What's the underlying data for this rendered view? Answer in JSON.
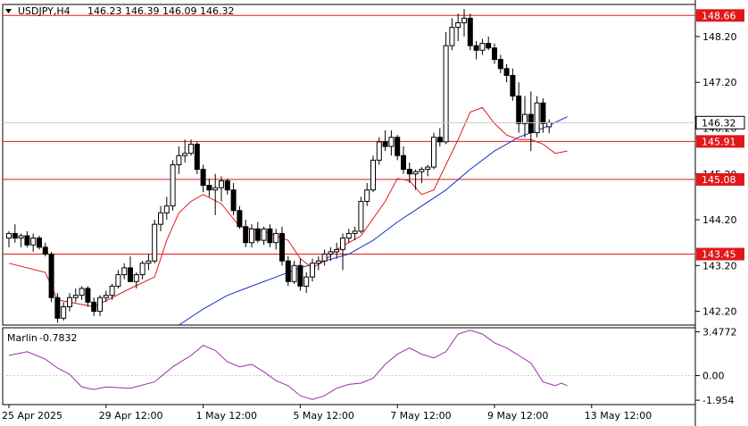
{
  "header": {
    "symbol": "USDJPY,H4",
    "ohlc": "146.23 146.39 146.09 146.32"
  },
  "indicator": {
    "name": "Marlin",
    "value": "-0.7832"
  },
  "colors": {
    "bull": "#ffffff",
    "bear": "#000000",
    "ma_fast": "#e0181c",
    "ma_slow": "#1030c8",
    "osc": "#9b2ea8",
    "level": "#e0181c",
    "grid": "#c8c8c8"
  },
  "chart_data": [
    {
      "type": "candlestick",
      "ylim": [
        141.9,
        148.9
      ],
      "price_ticks": [
        "148.20",
        "147.20",
        "146.20",
        "145.20",
        "144.20",
        "143.20",
        "142.20"
      ],
      "current_price": "146.32",
      "levels": [
        {
          "value": 148.66,
          "label": "148.66"
        },
        {
          "value": 145.91,
          "label": "145.91"
        },
        {
          "value": 145.08,
          "label": "145.08"
        },
        {
          "value": 143.45,
          "label": "143.45"
        }
      ],
      "time_labels": [
        "25 Apr 2025",
        "29 Apr 12:00",
        "1 May 12:00",
        "5 May 12:00",
        "7 May 12:00",
        "9 May 12:00",
        "13 May 12:00"
      ],
      "time_label_bars": [
        0,
        16,
        32,
        48,
        64,
        80,
        96
      ],
      "ohlc": [
        [
          143.8,
          143.95,
          143.6,
          143.9
        ],
        [
          143.9,
          144.1,
          143.7,
          143.8
        ],
        [
          143.8,
          143.9,
          143.6,
          143.85
        ],
        [
          143.85,
          143.95,
          143.6,
          143.65
        ],
        [
          143.65,
          143.9,
          143.5,
          143.8
        ],
        [
          143.8,
          143.85,
          143.55,
          143.6
        ],
        [
          143.6,
          143.7,
          143.4,
          143.45
        ],
        [
          143.45,
          143.5,
          142.4,
          142.5
        ],
        [
          142.5,
          142.6,
          141.95,
          142.05
        ],
        [
          142.05,
          142.4,
          142.0,
          142.3
        ],
        [
          142.3,
          142.6,
          142.2,
          142.5
        ],
        [
          142.5,
          142.7,
          142.4,
          142.55
        ],
        [
          142.55,
          142.75,
          142.45,
          142.7
        ],
        [
          142.7,
          142.75,
          142.3,
          142.4
        ],
        [
          142.4,
          142.5,
          142.1,
          142.2
        ],
        [
          142.2,
          142.55,
          142.1,
          142.5
        ],
        [
          142.5,
          142.65,
          142.4,
          142.55
        ],
        [
          142.55,
          142.8,
          142.45,
          142.75
        ],
        [
          142.75,
          143.1,
          142.7,
          143.0
        ],
        [
          143.0,
          143.25,
          142.9,
          143.15
        ],
        [
          143.15,
          143.4,
          143.0,
          142.85
        ],
        [
          142.85,
          143.05,
          142.7,
          143.0
        ],
        [
          143.0,
          143.3,
          142.9,
          143.25
        ],
        [
          143.25,
          143.45,
          143.1,
          143.3
        ],
        [
          143.3,
          144.2,
          143.25,
          144.1
        ],
        [
          144.1,
          144.5,
          143.95,
          144.35
        ],
        [
          144.35,
          144.7,
          144.2,
          144.5
        ],
        [
          144.5,
          145.5,
          144.4,
          145.4
        ],
        [
          145.4,
          145.8,
          145.2,
          145.6
        ],
        [
          145.6,
          145.95,
          145.45,
          145.65
        ],
        [
          145.65,
          145.95,
          145.6,
          145.85
        ],
        [
          145.85,
          145.9,
          145.2,
          145.3
        ],
        [
          145.3,
          145.4,
          144.8,
          144.95
        ],
        [
          144.95,
          145.1,
          144.7,
          144.85
        ],
        [
          144.85,
          145.2,
          144.3,
          144.9
        ],
        [
          144.9,
          145.15,
          144.6,
          145.05
        ],
        [
          145.05,
          145.1,
          144.75,
          144.85
        ],
        [
          144.85,
          145.0,
          144.3,
          144.4
        ],
        [
          144.4,
          144.5,
          144.0,
          144.05
        ],
        [
          144.05,
          144.2,
          143.6,
          143.7
        ],
        [
          143.7,
          144.1,
          143.6,
          144.0
        ],
        [
          144.0,
          144.15,
          143.7,
          143.75
        ],
        [
          143.75,
          144.05,
          143.65,
          144.0
        ],
        [
          144.0,
          144.1,
          143.6,
          143.7
        ],
        [
          143.7,
          144.0,
          143.55,
          143.9
        ],
        [
          143.9,
          144.05,
          143.2,
          143.3
        ],
        [
          143.3,
          143.4,
          142.75,
          142.85
        ],
        [
          142.85,
          143.3,
          142.8,
          143.2
        ],
        [
          143.2,
          143.35,
          142.65,
          142.75
        ],
        [
          142.75,
          143.05,
          142.6,
          142.95
        ],
        [
          142.95,
          143.35,
          142.85,
          143.25
        ],
        [
          143.25,
          143.4,
          143.1,
          143.3
        ],
        [
          143.3,
          143.55,
          143.2,
          143.45
        ],
        [
          143.45,
          143.6,
          143.3,
          143.5
        ],
        [
          143.5,
          143.7,
          143.35,
          143.55
        ],
        [
          143.55,
          143.9,
          143.1,
          143.8
        ],
        [
          143.8,
          144.0,
          143.7,
          143.9
        ],
        [
          143.9,
          144.05,
          143.75,
          143.95
        ],
        [
          143.95,
          144.7,
          143.9,
          144.6
        ],
        [
          144.6,
          145.0,
          144.5,
          144.85
        ],
        [
          144.85,
          145.6,
          144.8,
          145.5
        ],
        [
          145.5,
          146.0,
          145.4,
          145.9
        ],
        [
          145.9,
          146.15,
          145.7,
          145.8
        ],
        [
          145.8,
          146.15,
          145.6,
          146.0
        ],
        [
          146.0,
          146.05,
          145.5,
          145.6
        ],
        [
          145.6,
          145.8,
          145.2,
          145.3
        ],
        [
          145.3,
          145.45,
          145.0,
          145.2
        ],
        [
          145.2,
          145.3,
          144.85,
          145.25
        ],
        [
          145.25,
          145.35,
          145.0,
          145.3
        ],
        [
          145.3,
          145.4,
          145.15,
          145.35
        ],
        [
          145.35,
          146.1,
          145.3,
          146.0
        ],
        [
          146.0,
          146.2,
          145.8,
          145.9
        ],
        [
          145.9,
          148.3,
          145.85,
          148.0
        ],
        [
          148.0,
          148.6,
          147.9,
          148.4
        ],
        [
          148.4,
          148.7,
          148.1,
          148.5
        ],
        [
          148.5,
          148.8,
          148.2,
          148.6
        ],
        [
          148.6,
          148.7,
          147.9,
          148.0
        ],
        [
          148.0,
          148.1,
          147.7,
          147.9
        ],
        [
          147.9,
          148.15,
          147.8,
          148.05
        ],
        [
          148.05,
          148.2,
          147.9,
          147.95
        ],
        [
          147.95,
          148.05,
          147.6,
          147.7
        ],
        [
          147.7,
          147.8,
          147.4,
          147.5
        ],
        [
          147.5,
          147.6,
          147.2,
          147.35
        ],
        [
          147.35,
          147.5,
          146.8,
          146.9
        ],
        [
          146.9,
          147.2,
          146.1,
          146.3
        ],
        [
          146.3,
          146.9,
          146.0,
          146.5
        ],
        [
          146.5,
          147.0,
          145.7,
          146.1
        ],
        [
          146.1,
          146.9,
          146.0,
          146.75
        ],
        [
          146.75,
          146.85,
          146.1,
          146.3
        ],
        [
          146.23,
          146.39,
          146.09,
          146.32
        ]
      ],
      "ma_fast": [
        [
          0,
          143.25
        ],
        [
          6,
          143.05
        ],
        [
          8,
          142.45
        ],
        [
          14,
          142.3
        ],
        [
          20,
          142.7
        ],
        [
          24,
          142.95
        ],
        [
          26,
          143.75
        ],
        [
          28,
          144.35
        ],
        [
          30,
          144.6
        ],
        [
          32,
          144.75
        ],
        [
          35,
          144.55
        ],
        [
          38,
          144.05
        ],
        [
          42,
          143.95
        ],
        [
          46,
          143.75
        ],
        [
          48,
          143.35
        ],
        [
          50,
          143.15
        ],
        [
          52,
          143.3
        ],
        [
          54,
          143.55
        ],
        [
          58,
          143.85
        ],
        [
          62,
          144.6
        ],
        [
          64,
          145.1
        ],
        [
          66,
          145.05
        ],
        [
          68,
          144.75
        ],
        [
          70,
          144.85
        ],
        [
          72,
          145.4
        ],
        [
          74,
          145.95
        ],
        [
          76,
          146.55
        ],
        [
          78,
          146.65
        ],
        [
          80,
          146.3
        ],
        [
          82,
          146.05
        ],
        [
          84,
          145.95
        ],
        [
          86,
          145.95
        ],
        [
          88,
          145.85
        ],
        [
          90,
          145.65
        ],
        [
          92,
          145.7
        ]
      ],
      "ma_slow": [
        [
          28,
          141.9
        ],
        [
          32,
          142.25
        ],
        [
          36,
          142.55
        ],
        [
          40,
          142.75
        ],
        [
          44,
          142.95
        ],
        [
          48,
          143.15
        ],
        [
          52,
          143.3
        ],
        [
          56,
          143.45
        ],
        [
          60,
          143.75
        ],
        [
          64,
          144.15
        ],
        [
          68,
          144.5
        ],
        [
          72,
          144.85
        ],
        [
          76,
          145.3
        ],
        [
          80,
          145.7
        ],
        [
          84,
          146.0
        ],
        [
          88,
          146.2
        ],
        [
          92,
          146.45
        ]
      ]
    },
    {
      "type": "line",
      "name": "Marlin",
      "ylim": [
        -2.3,
        3.8
      ],
      "ticks": [
        "3.4772",
        "0.00",
        "-1.954"
      ],
      "values": [
        [
          0,
          1.6
        ],
        [
          3,
          1.9
        ],
        [
          6,
          1.3
        ],
        [
          8,
          0.6
        ],
        [
          10,
          0.1
        ],
        [
          12,
          -0.9
        ],
        [
          14,
          -1.1
        ],
        [
          16,
          -0.9
        ],
        [
          20,
          -1.0
        ],
        [
          24,
          -0.5
        ],
        [
          27,
          0.7
        ],
        [
          30,
          1.6
        ],
        [
          32,
          2.4
        ],
        [
          34,
          2.0
        ],
        [
          36,
          1.1
        ],
        [
          38,
          0.7
        ],
        [
          40,
          0.9
        ],
        [
          42,
          0.3
        ],
        [
          44,
          -0.4
        ],
        [
          46,
          -0.8
        ],
        [
          48,
          -1.6
        ],
        [
          50,
          -1.9
        ],
        [
          52,
          -1.6
        ],
        [
          54,
          -1.0
        ],
        [
          56,
          -0.7
        ],
        [
          58,
          -0.6
        ],
        [
          60,
          -0.2
        ],
        [
          62,
          0.9
        ],
        [
          64,
          1.7
        ],
        [
          66,
          2.2
        ],
        [
          68,
          1.7
        ],
        [
          70,
          1.4
        ],
        [
          72,
          1.9
        ],
        [
          74,
          3.3
        ],
        [
          76,
          3.6
        ],
        [
          78,
          3.3
        ],
        [
          80,
          2.6
        ],
        [
          82,
          2.2
        ],
        [
          84,
          1.6
        ],
        [
          86,
          1.0
        ],
        [
          88,
          -0.5
        ],
        [
          90,
          -0.8
        ],
        [
          91,
          -0.6
        ],
        [
          92,
          -0.8
        ]
      ]
    }
  ]
}
